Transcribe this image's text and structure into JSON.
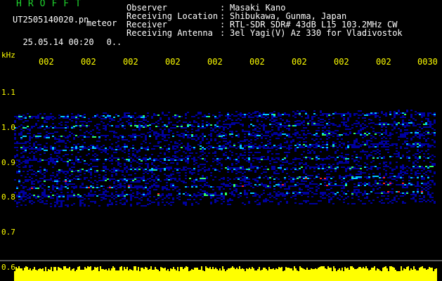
{
  "header": {
    "app_title": "HROFFT",
    "filename": "UT2505140020.pn",
    "meteor_label": "meteor",
    "date_time": "25.05.14 00:20",
    "counter": "0..",
    "info_labels": "Observer\nReceiving Location\nReceiver\nReceiving Antenna",
    "info_colons": ":\n:\n:\n:",
    "info_values": "Masaki Kano\nShibukawa, Gunma, Japan\nRTL-SDR SDR# 43dB L15 103.2MHz CW\n3el Yagi(V) Az 330 for Vladivostok"
  },
  "axis": {
    "unit_label": "kHz",
    "y_ticks": [
      "1.1",
      "1.0",
      "0.9",
      "0.8",
      "0.7",
      "0.6"
    ],
    "time_ticks": [
      "002",
      "002",
      "002",
      "002",
      "002",
      "002",
      "002",
      "002",
      "002",
      "0030"
    ]
  },
  "colors": {
    "text": "#ffffff",
    "title": "#1fd62e",
    "axis": "#ffff00",
    "background": "#000000",
    "waterfall_low": "#0000a0",
    "waterfall_mid": "#00c8ff",
    "waterfall_high": "#ff2020",
    "signal_bar": "#ffff00"
  }
}
